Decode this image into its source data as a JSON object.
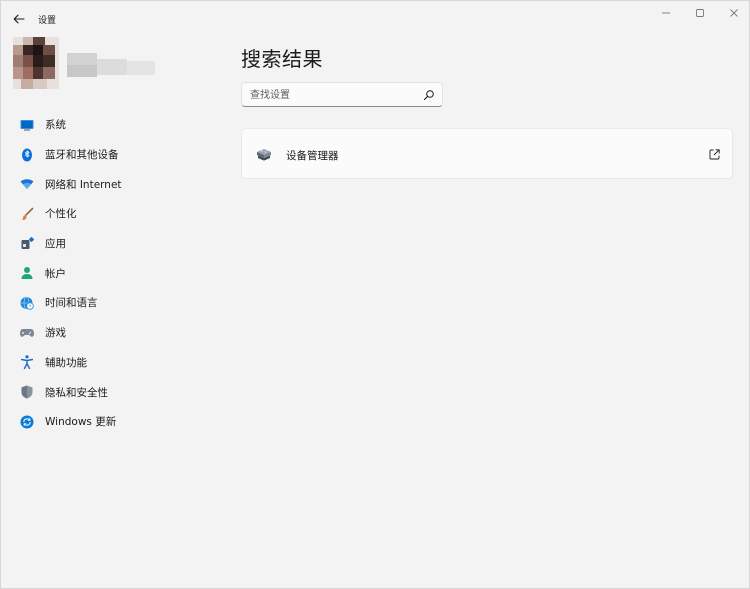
{
  "window": {
    "title": "设置"
  },
  "sidebar": {
    "items": [
      {
        "label": "系统",
        "icon": "system-monitor-icon",
        "color": "#0067c0"
      },
      {
        "label": "蓝牙和其他设备",
        "icon": "bluetooth-icon",
        "color": "#0a6fd8"
      },
      {
        "label": "网络和 Internet",
        "icon": "wifi-icon",
        "color": "#1a73d9"
      },
      {
        "label": "个性化",
        "icon": "paintbrush-icon",
        "color": "#e1803a"
      },
      {
        "label": "应用",
        "icon": "apps-icon",
        "color": "#4a5a6b"
      },
      {
        "label": "帐户",
        "icon": "account-icon",
        "color": "#1fa57e"
      },
      {
        "label": "时间和语言",
        "icon": "globe-clock-icon",
        "color": "#1e88d8"
      },
      {
        "label": "游戏",
        "icon": "gamepad-icon",
        "color": "#7b8794"
      },
      {
        "label": "辅助功能",
        "icon": "accessibility-icon",
        "color": "#1a6fcb"
      },
      {
        "label": "隐私和安全性",
        "icon": "shield-icon",
        "color": "#6b7785"
      },
      {
        "label": "Windows 更新",
        "icon": "windows-update-icon",
        "color": "#0a7bd6"
      }
    ]
  },
  "main": {
    "title": "搜索结果",
    "search": {
      "placeholder": "查找设置",
      "value": ""
    },
    "results": [
      {
        "label": "设备管理器",
        "icon": "device-manager-icon"
      }
    ]
  }
}
